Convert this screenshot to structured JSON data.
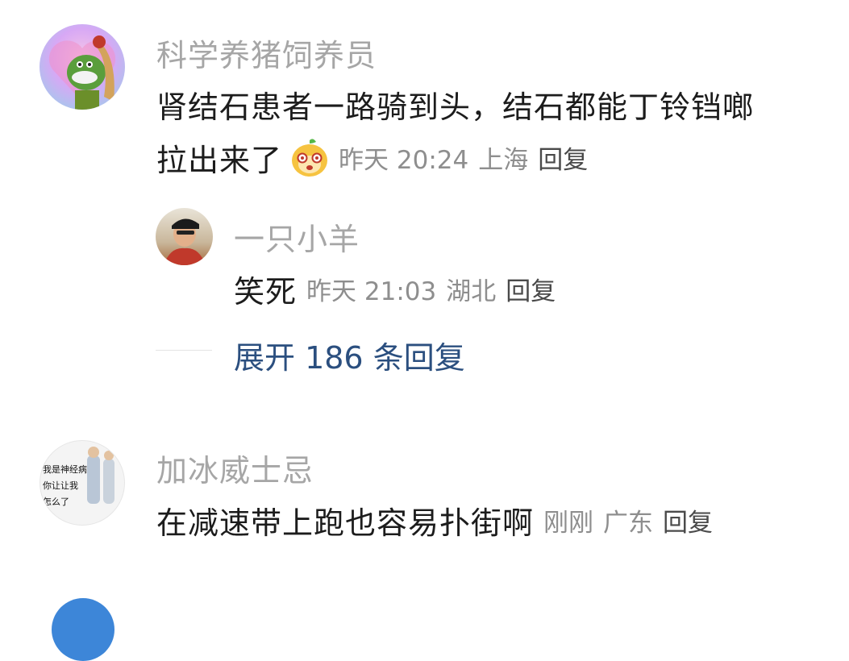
{
  "comments": [
    {
      "author": "科学养猪饲养员",
      "text_line1": "肾结石患者一路骑到头，结石都能丁铃铛啷",
      "text_line2": "拉出来了",
      "emoji": "monkey-emoji",
      "time": "昨天 20:24",
      "location": "上海",
      "reply_label": "回复",
      "replies": [
        {
          "author": "一只小羊",
          "text": "笑死",
          "time": "昨天 21:03",
          "location": "湖北",
          "reply_label": "回复"
        }
      ],
      "expand_label": "展开 186 条回复"
    },
    {
      "author": "加冰威士忌",
      "avatar_text": [
        "我是神经病",
        "你让让我",
        "怎么了"
      ],
      "text": "在减速带上跑也容易扑街啊",
      "time": "刚刚",
      "location": "广东",
      "reply_label": "回复"
    }
  ]
}
